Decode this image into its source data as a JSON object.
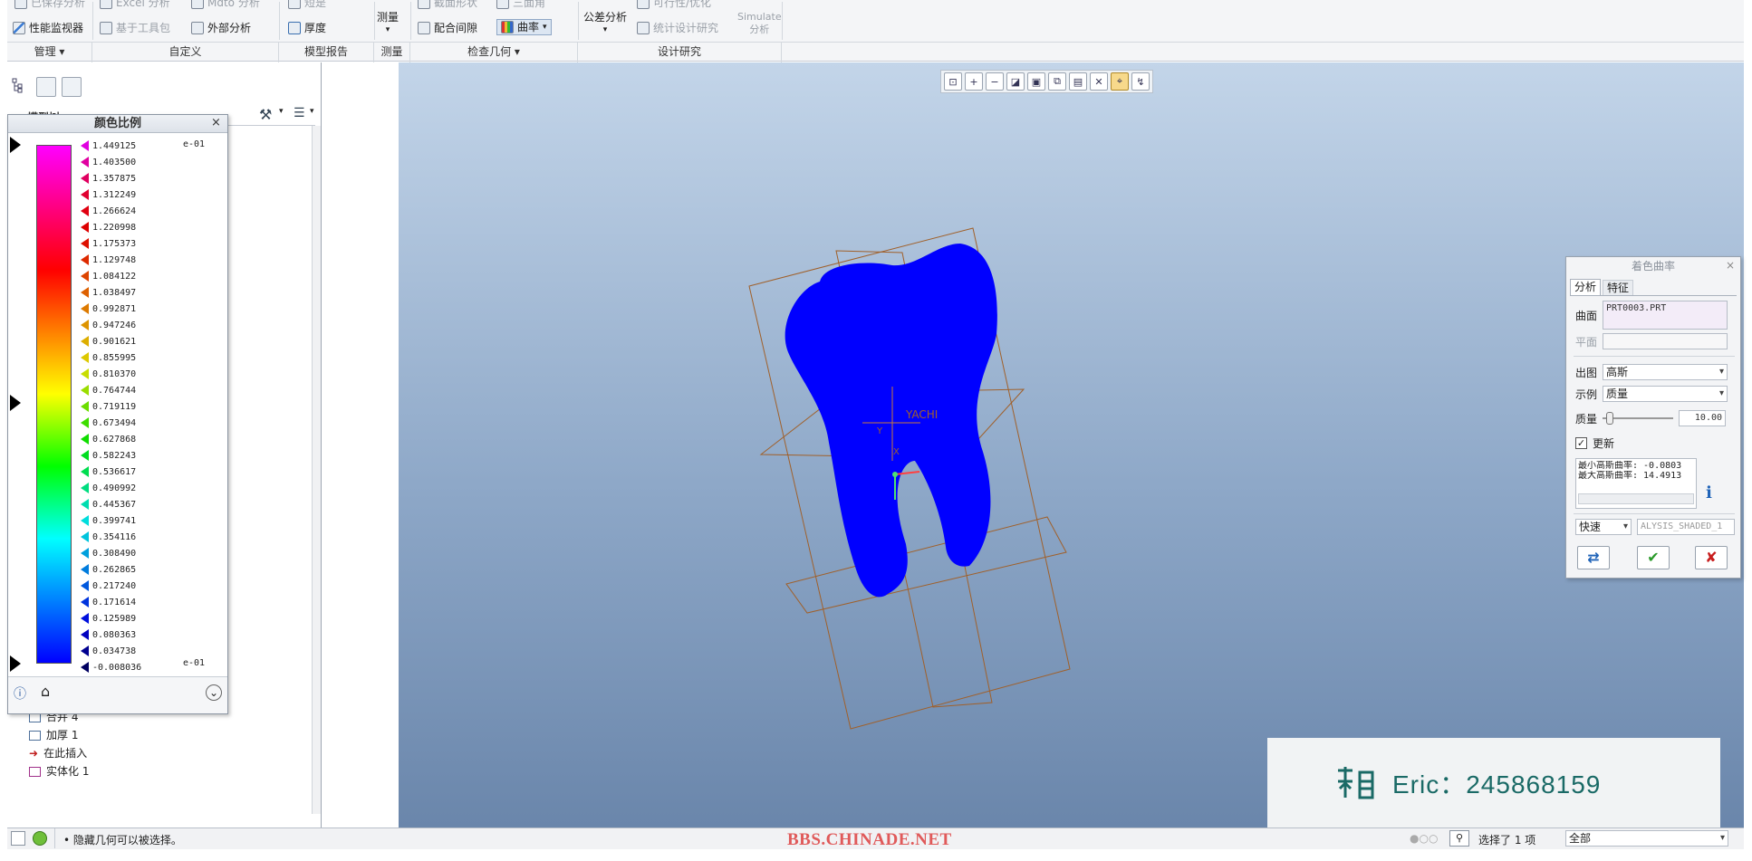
{
  "ribbon": {
    "row1": [
      "已保存分析",
      "Excel 分析",
      "Mdto 分析",
      "短是",
      "测量",
      "截面形状",
      "三面角",
      "公差分析",
      "可行性/优化",
      "Simulate"
    ],
    "perf_monitor": "性能监视器",
    "toolkit": "基于工具包",
    "external": "外部分析",
    "thickness": "厚度",
    "measure": "测量",
    "clearance": "配合间隙",
    "curvature": "曲率",
    "tolerance": "公差分析",
    "stat_design": "统计设计研究",
    "simulate": "Simulate",
    "simulate_sub": "分析",
    "groups": [
      "管理",
      "自定义",
      "模型报告",
      "测量",
      "检查几何",
      "设计研究"
    ]
  },
  "model_tree": {
    "header": "模型树",
    "items": [
      "合并 4",
      "加厚 1",
      "在此插入",
      "实体化 1"
    ]
  },
  "color_scale": {
    "title": "颜色比例",
    "exponent": "e-01",
    "values": [
      "1.449125",
      "1.403500",
      "1.357875",
      "1.312249",
      "1.266624",
      "1.220998",
      "1.175373",
      "1.129748",
      "1.084122",
      "1.038497",
      "0.992871",
      "0.947246",
      "0.901621",
      "0.855995",
      "0.810370",
      "0.764744",
      "0.719119",
      "0.673494",
      "0.627868",
      "0.582243",
      "0.536617",
      "0.490992",
      "0.445367",
      "0.399741",
      "0.354116",
      "0.308490",
      "0.262865",
      "0.217240",
      "0.171614",
      "0.125989",
      "0.080363",
      "0.034738",
      "-0.008036"
    ],
    "marker_colors": [
      "#e000e0",
      "#e000a0",
      "#e00060",
      "#e00030",
      "#e00010",
      "#dd0000",
      "#dd1000",
      "#dd2a00",
      "#dd4400",
      "#dd6000",
      "#dd7a00",
      "#dd9400",
      "#ddae00",
      "#ddc800",
      "#c8dd00",
      "#9add00",
      "#6cdd00",
      "#3edd00",
      "#10dd00",
      "#00dd20",
      "#00dd50",
      "#00dd80",
      "#00ddb0",
      "#00dddd",
      "#00c4dd",
      "#00a0dd",
      "#007cdd",
      "#0058dd",
      "#0034dd",
      "#0010dd",
      "#0000c0",
      "#000090",
      "#000060"
    ]
  },
  "viewport": {
    "csys_label": "YACHI",
    "axis_y": "Y",
    "axis_x": "X",
    "model_fill": "#0000ff",
    "datum_color": "#a0602a"
  },
  "dialog": {
    "title": "着色曲率",
    "tab_analysis": "分析",
    "tab_feature": "特征",
    "surface_label": "曲面",
    "surface_value": "PRT0003.PRT",
    "plane_label": "平面",
    "output_label": "出图",
    "output_value": "高斯",
    "sample_label": "示例",
    "sample_value": "质量",
    "quality_label": "质量",
    "quality_value": "10.00",
    "quality_level": 0.05,
    "update_label": "更新",
    "min_label": "最小高斯曲率: -0.0803",
    "max_label": "最大高斯曲率: 14.4913",
    "mode_value": "快速",
    "name_value": "ALYSIS_SHADED_1"
  },
  "watermark": {
    "text": "Eric：245868159"
  },
  "status": {
    "message": "隐藏几何可以被选择。",
    "site": "BBS.CHINADE.NET",
    "selected": "选择了 1 项",
    "filter": "全部"
  }
}
